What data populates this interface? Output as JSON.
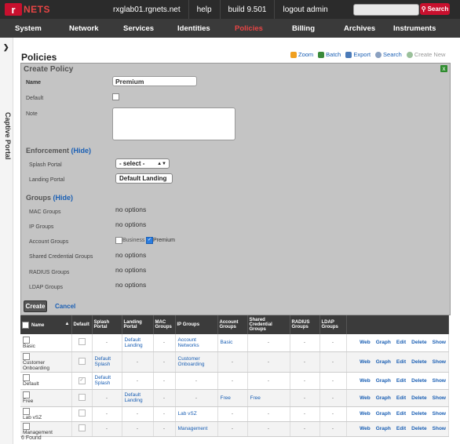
{
  "topbar": {
    "logo_mark": "r",
    "logo_text": "NETS",
    "host": "rxglab01.rgnets.net",
    "help": "help",
    "build": "build 9.501",
    "logout": "logout admin",
    "search_button": "Search"
  },
  "nav": [
    "System",
    "Network",
    "Services",
    "Identities",
    "Policies",
    "Billing",
    "Archives",
    "Instruments"
  ],
  "nav_active": "Policies",
  "sidebar": {
    "label": "Captive Portal"
  },
  "page": {
    "title": "Policies",
    "actions": [
      "Zoom",
      "Batch",
      "Export",
      "Search",
      "Create New"
    ]
  },
  "form": {
    "title": "Create Policy",
    "name_label": "Name",
    "name_value": "Premium",
    "default_label": "Default",
    "note_label": "Note",
    "enforcement_title": "Enforcement",
    "enforcement_toggle": "(Hide)",
    "splash_label": "Splash Portal",
    "splash_value": "- select -",
    "landing_label": "Landing Portal",
    "landing_value": "Default Landing",
    "groups_title": "Groups",
    "groups_toggle": "(Hide)",
    "mac_label": "MAC Groups",
    "ip_label": "IP Groups",
    "account_label": "Account Groups",
    "shared_label": "Shared Credential Groups",
    "radius_label": "RADIUS Groups",
    "ldap_label": "LDAP Groups",
    "no_options": "no options",
    "account_opt1": "Business",
    "account_opt2": "Premium",
    "create": "Create",
    "cancel": "Cancel"
  },
  "table": {
    "headers": [
      "Name",
      "Default",
      "Splash Portal",
      "Landing Portal",
      "MAC Groups",
      "IP Groups",
      "Account Groups",
      "Shared Credential Groups",
      "RADIUS Groups",
      "LDAP Groups"
    ],
    "row_actions": [
      "Web",
      "Graph",
      "Edit",
      "Delete",
      "Show"
    ],
    "rows": [
      {
        "name": "Basic",
        "default": "",
        "splash": "-",
        "landing": "Default Landing",
        "mac": "-",
        "ip": "Account Networks",
        "account": "Basic",
        "shared": "-",
        "radius": "-",
        "ldap": "-"
      },
      {
        "name": "Customer Onboarding",
        "default": "",
        "splash": "Default Splash",
        "landing": "-",
        "mac": "-",
        "ip": "Customer Onboarding",
        "account": "-",
        "shared": "-",
        "radius": "-",
        "ldap": "-"
      },
      {
        "name": "Default",
        "default": "✓",
        "splash": "Default Splash",
        "landing": "-",
        "mac": "-",
        "ip": "-",
        "account": "-",
        "shared": "-",
        "radius": "-",
        "ldap": "-"
      },
      {
        "name": "Free",
        "default": "",
        "splash": "-",
        "landing": "Default Landing",
        "mac": "-",
        "ip": "-",
        "account": "Free",
        "shared": "Free",
        "radius": "-",
        "ldap": "-"
      },
      {
        "name": "Lab vSZ",
        "default": "",
        "splash": "-",
        "landing": "-",
        "mac": "-",
        "ip": "Lab vSZ",
        "account": "-",
        "shared": "-",
        "radius": "-",
        "ldap": "-"
      },
      {
        "name": "Management",
        "default": "",
        "splash": "-",
        "landing": "-",
        "mac": "-",
        "ip": "Management",
        "account": "-",
        "shared": "-",
        "radius": "-",
        "ldap": "-"
      }
    ],
    "found": "6 Found"
  }
}
